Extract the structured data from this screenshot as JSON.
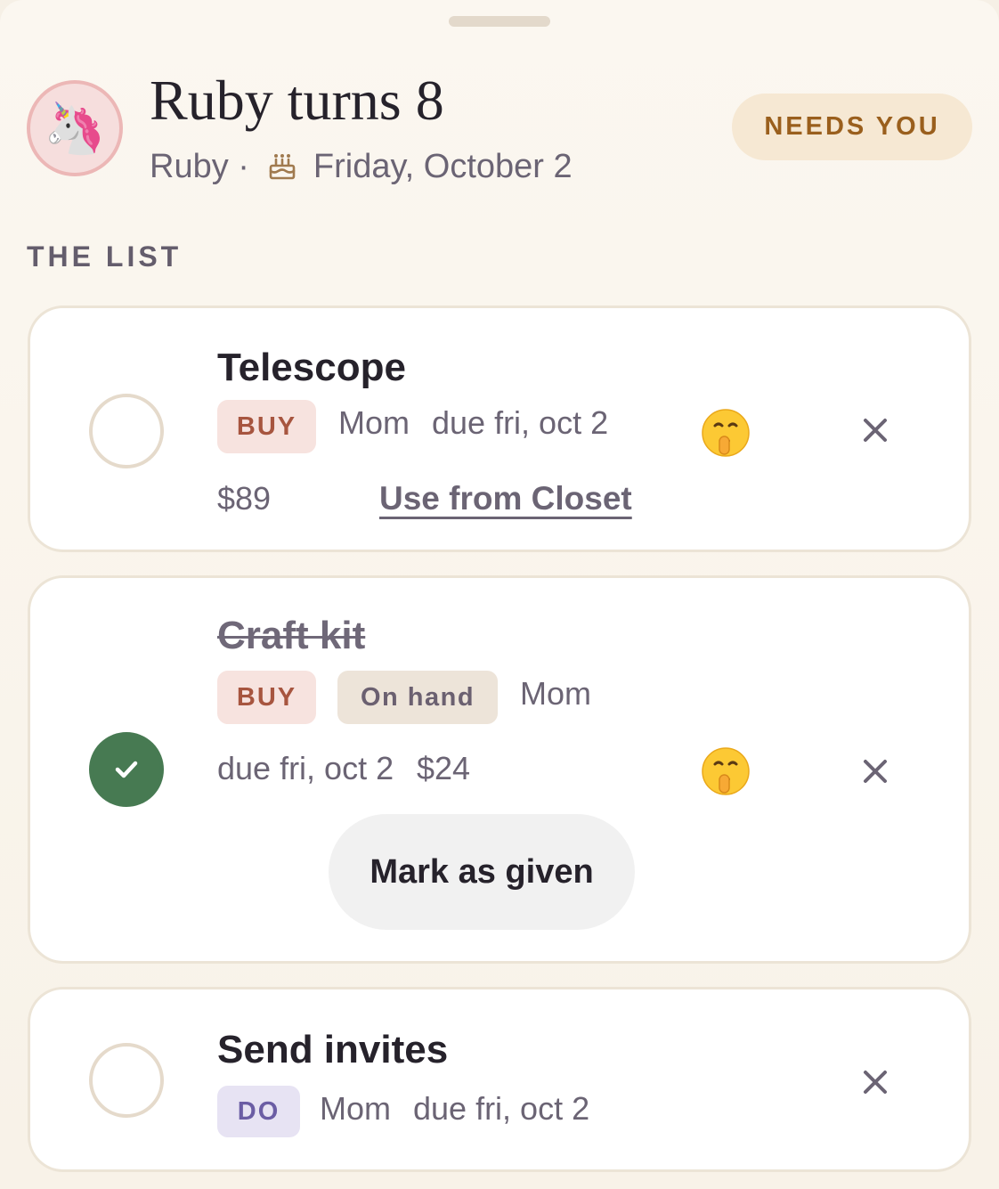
{
  "header": {
    "avatar_emoji": "🦄",
    "title": "Ruby turns 8",
    "person": "Ruby ·",
    "date": "Friday, October 2",
    "status_pill": "NEEDS YOU"
  },
  "section_label": "THE LIST",
  "items": [
    {
      "title": "Telescope",
      "done": false,
      "tag": "BUY",
      "assignee": "Mom",
      "due": "due fri, oct 2",
      "price": "$89",
      "action_link": "Use from Closet",
      "secret": true
    },
    {
      "title": "Craft kit",
      "done": true,
      "tag": "BUY",
      "status_tag": "On hand",
      "assignee": "Mom",
      "due": "due fri, oct 2",
      "price": "$24",
      "primary_action": "Mark as given",
      "secret": true
    },
    {
      "title": "Send invites",
      "done": false,
      "tag": "DO",
      "assignee": "Mom",
      "due": "due fri, oct 2",
      "secret": false
    }
  ],
  "icons": {
    "secret": "shushing-face-icon",
    "remove": "close-icon",
    "date": "cake-icon",
    "done": "checkmark-icon"
  },
  "colors": {
    "accent_done": "#477a52",
    "needs_you_bg": "#f6e8d3",
    "needs_you_text": "#9a5f1d",
    "tag_buy": "#a7553f",
    "tag_do": "#6b5da4"
  }
}
